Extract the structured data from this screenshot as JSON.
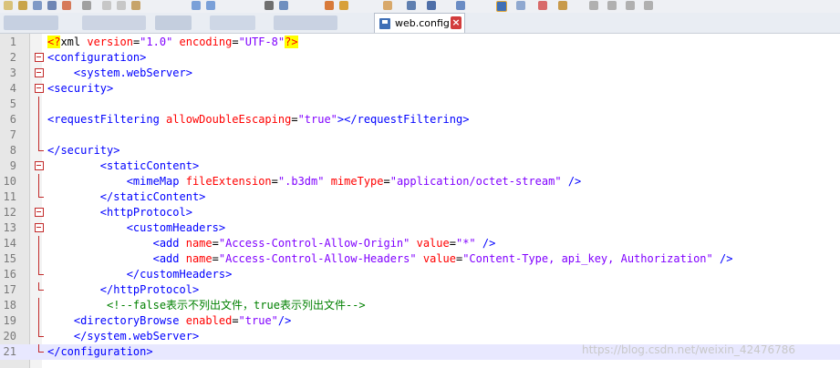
{
  "window": {
    "tab_label": "web.config",
    "tab_close_glyph": "×"
  },
  "colors": {
    "tag": "#0000ff",
    "attribute": "#ff0000",
    "value": "#8000ff",
    "processing_instruction_bg": "#ffff00",
    "comment": "#008000",
    "fold_marker": "#c22a2a",
    "current_line": "#e8e8ff"
  },
  "icons": [
    "save-icon",
    "close-icon",
    "fold-marker-icon"
  ],
  "editor": {
    "current_line": 21,
    "lines": [
      {
        "number": "1",
        "indent": "",
        "fold": "",
        "segments": [
          {
            "t": "pi",
            "s": "<?"
          },
          {
            "t": "plain",
            "s": "xml "
          },
          {
            "t": "attr",
            "s": "version"
          },
          {
            "t": "plain",
            "s": "="
          },
          {
            "t": "val",
            "s": "\"1.0\""
          },
          {
            "t": "plain",
            "s": " "
          },
          {
            "t": "attr",
            "s": "encoding"
          },
          {
            "t": "plain",
            "s": "="
          },
          {
            "t": "val",
            "s": "\"UTF-8\""
          },
          {
            "t": "pi",
            "s": "?>"
          }
        ]
      },
      {
        "number": "2",
        "indent": "",
        "fold": "box",
        "segments": [
          {
            "t": "tag",
            "s": "<configuration>"
          }
        ]
      },
      {
        "number": "3",
        "indent": "    ",
        "fold": "box",
        "segments": [
          {
            "t": "tag",
            "s": "<system.webServer>"
          }
        ]
      },
      {
        "number": "4",
        "indent": "",
        "fold": "box",
        "segments": [
          {
            "t": "tag",
            "s": "<security>"
          }
        ]
      },
      {
        "number": "5",
        "indent": "",
        "fold": "vline",
        "segments": []
      },
      {
        "number": "6",
        "indent": "",
        "fold": "vline",
        "segments": [
          {
            "t": "tag",
            "s": "<requestFiltering "
          },
          {
            "t": "attr",
            "s": "allowDoubleEscaping"
          },
          {
            "t": "plain",
            "s": "="
          },
          {
            "t": "val",
            "s": "\"true\""
          },
          {
            "t": "tag",
            "s": "></requestFiltering>"
          }
        ]
      },
      {
        "number": "7",
        "indent": "",
        "fold": "vline",
        "segments": []
      },
      {
        "number": "8",
        "indent": "",
        "fold": "end",
        "segments": [
          {
            "t": "tag",
            "s": "</security>"
          }
        ]
      },
      {
        "number": "9",
        "indent": "        ",
        "fold": "box",
        "segments": [
          {
            "t": "tag",
            "s": "<staticContent>"
          }
        ]
      },
      {
        "number": "10",
        "indent": "            ",
        "fold": "vline",
        "segments": [
          {
            "t": "tag",
            "s": "<mimeMap "
          },
          {
            "t": "attr",
            "s": "fileExtension"
          },
          {
            "t": "plain",
            "s": "="
          },
          {
            "t": "val",
            "s": "\".b3dm\""
          },
          {
            "t": "plain",
            "s": " "
          },
          {
            "t": "attr",
            "s": "mimeType"
          },
          {
            "t": "plain",
            "s": "="
          },
          {
            "t": "val",
            "s": "\"application/octet-stream\""
          },
          {
            "t": "plain",
            "s": " "
          },
          {
            "t": "tag",
            "s": "/>"
          }
        ]
      },
      {
        "number": "11",
        "indent": "        ",
        "fold": "end",
        "segments": [
          {
            "t": "tag",
            "s": "</staticContent>"
          }
        ]
      },
      {
        "number": "12",
        "indent": "        ",
        "fold": "box",
        "segments": [
          {
            "t": "tag",
            "s": "<httpProtocol>"
          }
        ]
      },
      {
        "number": "13",
        "indent": "            ",
        "fold": "box",
        "segments": [
          {
            "t": "tag",
            "s": "<customHeaders>"
          }
        ]
      },
      {
        "number": "14",
        "indent": "                ",
        "fold": "vline",
        "segments": [
          {
            "t": "tag",
            "s": "<add "
          },
          {
            "t": "attr",
            "s": "name"
          },
          {
            "t": "plain",
            "s": "="
          },
          {
            "t": "val",
            "s": "\"Access-Control-Allow-Origin\""
          },
          {
            "t": "plain",
            "s": " "
          },
          {
            "t": "attr",
            "s": "value"
          },
          {
            "t": "plain",
            "s": "="
          },
          {
            "t": "val",
            "s": "\"*\""
          },
          {
            "t": "plain",
            "s": " "
          },
          {
            "t": "tag",
            "s": "/>"
          }
        ]
      },
      {
        "number": "15",
        "indent": "                ",
        "fold": "vline",
        "segments": [
          {
            "t": "tag",
            "s": "<add "
          },
          {
            "t": "attr",
            "s": "name"
          },
          {
            "t": "plain",
            "s": "="
          },
          {
            "t": "val",
            "s": "\"Access-Control-Allow-Headers\""
          },
          {
            "t": "plain",
            "s": " "
          },
          {
            "t": "attr",
            "s": "value"
          },
          {
            "t": "plain",
            "s": "="
          },
          {
            "t": "val",
            "s": "\"Content-Type, api_key, Authorization\""
          },
          {
            "t": "plain",
            "s": " "
          },
          {
            "t": "tag",
            "s": "/>"
          }
        ]
      },
      {
        "number": "16",
        "indent": "            ",
        "fold": "end",
        "segments": [
          {
            "t": "tag",
            "s": "</customHeaders>"
          }
        ]
      },
      {
        "number": "17",
        "indent": "        ",
        "fold": "end",
        "segments": [
          {
            "t": "tag",
            "s": "</httpProtocol>"
          }
        ]
      },
      {
        "number": "18",
        "indent": "         ",
        "fold": "vline",
        "segments": [
          {
            "t": "comment",
            "s": "<!--false表示不列出文件，true表示列出文件-->"
          }
        ]
      },
      {
        "number": "19",
        "indent": "    ",
        "fold": "vline",
        "segments": [
          {
            "t": "tag",
            "s": "<directoryBrowse "
          },
          {
            "t": "attr",
            "s": "enabled"
          },
          {
            "t": "plain",
            "s": "="
          },
          {
            "t": "val",
            "s": "\"true\""
          },
          {
            "t": "tag",
            "s": "/>"
          }
        ]
      },
      {
        "number": "20",
        "indent": "    ",
        "fold": "end",
        "segments": [
          {
            "t": "tag",
            "s": "</system.webServer>"
          }
        ]
      },
      {
        "number": "21",
        "indent": "",
        "fold": "end",
        "segments": [
          {
            "t": "tag",
            "s": "</configuration>"
          }
        ]
      }
    ]
  },
  "watermark": "https://blog.csdn.net/weixin_42476786"
}
